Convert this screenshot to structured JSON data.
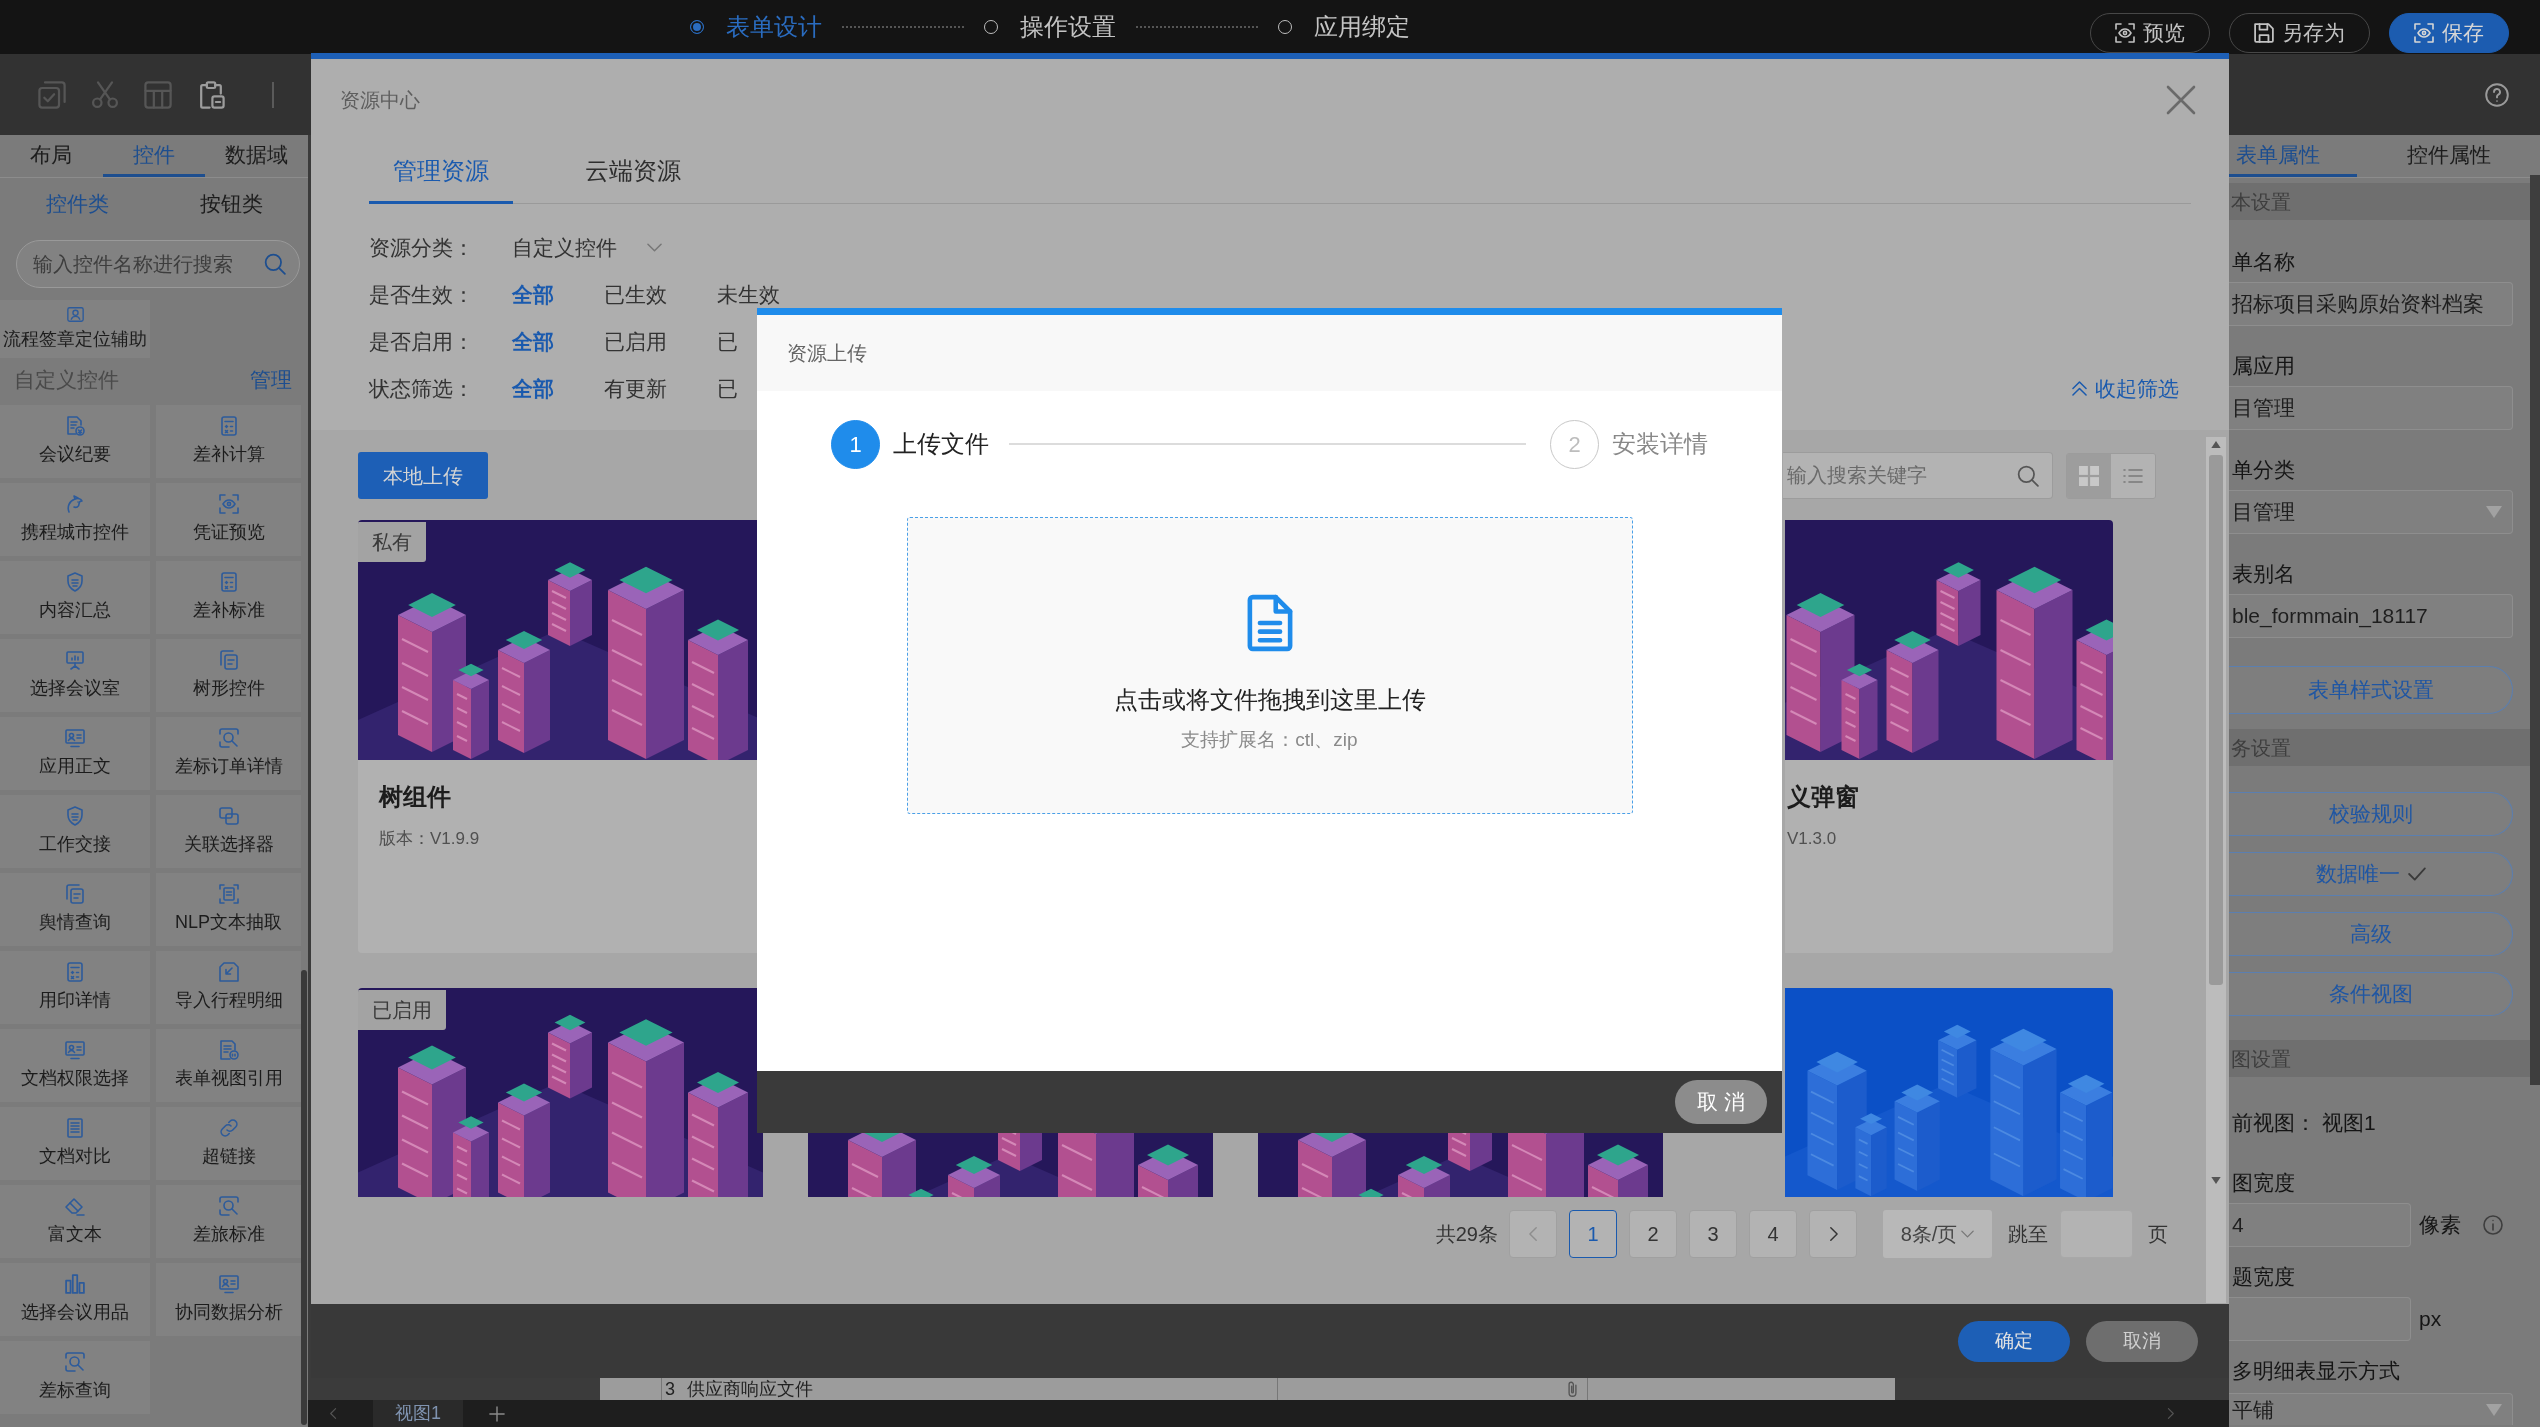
{
  "top_bar": {
    "steps": [
      {
        "label": "表单设计",
        "selected": true
      },
      {
        "label": "操作设置",
        "selected": false
      },
      {
        "label": "应用绑定",
        "selected": false
      }
    ],
    "buttons": [
      {
        "label": "预览",
        "kind": "eye",
        "primary": false
      },
      {
        "label": "另存为",
        "kind": "save",
        "primary": false
      },
      {
        "label": "保存",
        "kind": "eye",
        "primary": true
      }
    ]
  },
  "toolbar": {
    "tools": [
      {
        "kind": "check",
        "disabled": true
      },
      {
        "kind": "cut",
        "disabled": true
      },
      {
        "kind": "table",
        "disabled": true
      },
      {
        "kind": "paste",
        "disabled": false
      }
    ]
  },
  "left_panel": {
    "tabs": [
      {
        "label": "布局",
        "selected": false
      },
      {
        "label": "控件",
        "selected": true
      },
      {
        "label": "数据域",
        "selected": false
      }
    ],
    "subtabs": [
      {
        "label": "控件类",
        "selected": true
      },
      {
        "label": "按钮类",
        "selected": false
      }
    ],
    "search": {
      "placeholder": "输入控件名称进行搜索"
    },
    "items": [
      {
        "label": "流程签章定位辅助",
        "kind": "badge"
      }
    ],
    "custom_section": {
      "title": "自定义控件",
      "action": "管理"
    },
    "custom_items": [
      {
        "label": "会议纪要",
        "kind": "receipt"
      },
      {
        "label": "差补计算",
        "kind": "calculator"
      },
      {
        "label": "携程城市控件",
        "kind": "curl"
      },
      {
        "label": "凭证预览",
        "kind": "eye"
      },
      {
        "label": "内容汇总",
        "kind": "shield"
      },
      {
        "label": "差补标准",
        "kind": "calculator"
      },
      {
        "label": "选择会议室",
        "kind": "board"
      },
      {
        "label": "树形控件",
        "kind": "copies"
      },
      {
        "label": "应用正文",
        "kind": "card"
      },
      {
        "label": "差标订单详情",
        "kind": "lens"
      },
      {
        "label": "工作交接",
        "kind": "shield"
      },
      {
        "label": "关联选择器",
        "kind": "squares"
      },
      {
        "label": "舆情查询",
        "kind": "copies"
      },
      {
        "label": "NLP文本抽取",
        "kind": "docframe"
      },
      {
        "label": "用印详情",
        "kind": "calculator"
      },
      {
        "label": "导入行程明细",
        "kind": "import"
      },
      {
        "label": "文档权限选择",
        "kind": "card"
      },
      {
        "label": "表单视图引用",
        "kind": "quote"
      },
      {
        "label": "文档对比",
        "kind": "stack"
      },
      {
        "label": "超链接",
        "kind": "link"
      },
      {
        "label": "富文本",
        "kind": "eraser"
      },
      {
        "label": "差旅标准",
        "kind": "lens"
      },
      {
        "label": "选择会议用品",
        "kind": "bars"
      },
      {
        "label": "协同数据分析",
        "kind": "card"
      },
      {
        "label": "差标查询",
        "kind": "lens"
      }
    ]
  },
  "canvas": {
    "row": {
      "number": "3",
      "title": "供应商响应文件",
      "attachment": true
    },
    "view_tabs": [
      {
        "label": "视图1",
        "selected": true
      }
    ]
  },
  "right_panel": {
    "tabs": [
      {
        "label": "表单属性",
        "selected": true
      },
      {
        "label": "控件属性",
        "selected": false
      }
    ],
    "sections": [
      {
        "title": "本设置",
        "rows": [
          {
            "kind": "input",
            "label": "单名称",
            "value": "招标项目采购原始资料档案"
          },
          {
            "kind": "input",
            "label": "属应用",
            "value": "目管理"
          },
          {
            "kind": "select",
            "label": "单分类",
            "value": "目管理"
          },
          {
            "kind": "input",
            "label": "表别名",
            "value": "ble_formmain_18117"
          },
          {
            "kind": "button",
            "label": "表单样式设置",
            "checked": false
          }
        ]
      },
      {
        "title": "务设置",
        "rows": [
          {
            "kind": "button",
            "label": "校验规则",
            "checked": false
          },
          {
            "kind": "button",
            "label": "数据唯一",
            "checked": true
          },
          {
            "kind": "button",
            "label": "高级",
            "checked": false
          },
          {
            "kind": "button",
            "label": "条件视图",
            "checked": false
          }
        ]
      },
      {
        "title": "图设置",
        "rows": [
          {
            "kind": "text",
            "label": "前视图：",
            "value": "视图1"
          },
          {
            "kind": "input",
            "label": "图宽度",
            "value": "4",
            "unit": "像素",
            "info": true
          },
          {
            "kind": "input",
            "label": "题宽度",
            "unit": "px",
            "info": false
          },
          {
            "kind": "select",
            "label": "多明细表显示方式",
            "value": "平铺"
          }
        ]
      }
    ]
  },
  "resource_dialog": {
    "title": "资源中心",
    "tabs": [
      {
        "label": "管理资源",
        "selected": true
      },
      {
        "label": "云端资源",
        "selected": false
      }
    ],
    "filters": [
      {
        "kind": "select",
        "label": "资源分类：",
        "value": "自定义控件"
      },
      {
        "kind": "options",
        "label": "是否生效：",
        "options": [
          {
            "label": "全部",
            "selected": true
          },
          {
            "label": "已生效",
            "selected": false
          },
          {
            "label": "未生效",
            "selected": false
          }
        ]
      },
      {
        "kind": "options",
        "label": "是否启用：",
        "options": [
          {
            "label": "全部",
            "selected": true
          },
          {
            "label": "已启用",
            "selected": false
          },
          {
            "label": "已",
            "selected": false
          }
        ]
      },
      {
        "kind": "options",
        "label": "状态筛选：",
        "options": [
          {
            "label": "全部",
            "selected": true
          },
          {
            "label": "有更新",
            "selected": false
          },
          {
            "label": "已",
            "selected": false
          }
        ]
      }
    ],
    "collapse_link": "收起筛选",
    "upload_button": "本地上传",
    "search": {
      "placeholder": "输入搜索关键字"
    },
    "view_modes": [
      {
        "kind": "grid",
        "selected": true
      },
      {
        "kind": "list",
        "selected": false
      }
    ],
    "cards": [
      {
        "kind": "dark",
        "badge": "私有",
        "title": "树组件",
        "version": "版本：V1.9.9"
      },
      {
        "kind": "dark",
        "title": "义弹窗",
        "version": "V1.3.0"
      },
      {
        "kind": "dark",
        "badge": "已启用"
      },
      {
        "kind": "dark"
      },
      {
        "kind": "dark"
      },
      {
        "kind": "bright"
      }
    ],
    "pagination": {
      "total": "共29条",
      "prev_disabled": true,
      "pages": [
        {
          "label": "1",
          "selected": true
        },
        {
          "label": "2",
          "selected": false
        },
        {
          "label": "3",
          "selected": false
        },
        {
          "label": "4",
          "selected": false
        }
      ],
      "next_disabled": false,
      "page_size": "8条/页",
      "jump_label": "跳至",
      "jump_suffix": "页"
    },
    "buttons": [
      {
        "label": "确定",
        "primary": true
      },
      {
        "label": "取消",
        "primary": false
      }
    ]
  },
  "upload_dialog": {
    "title": "资源上传",
    "steps": [
      {
        "number": "1",
        "label": "上传文件",
        "selected": true
      },
      {
        "number": "2",
        "label": "安装详情",
        "selected": false
      }
    ],
    "dropzone": {
      "text": "点击或将文件拖拽到这里上传",
      "hint": "支持扩展名：ctl、zip"
    },
    "buttons": [
      {
        "label": "取 消"
      }
    ]
  }
}
